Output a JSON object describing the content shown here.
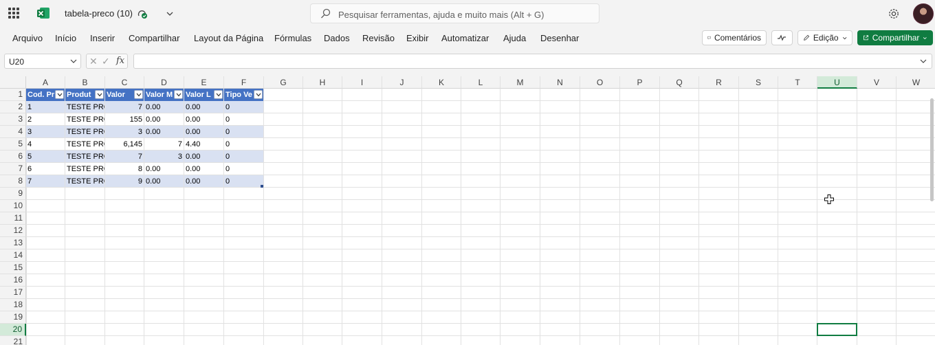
{
  "app": {
    "doc_title": "tabela-preco (10)",
    "search_placeholder": "Pesquisar ferramentas, ajuda e muito mais (Alt + G)"
  },
  "menu": [
    "Arquivo",
    "Início",
    "Inserir",
    "Compartilhar",
    "Layout da Página",
    "Fórmulas",
    "Dados",
    "Revisão",
    "Exibir",
    "Automatizar",
    "Ajuda",
    "Desenhar"
  ],
  "ribbon_buttons": {
    "comments": "Comentários",
    "editing": "Edição",
    "share": "Compartilhar"
  },
  "formula_bar": {
    "name_box": "U20",
    "formula": ""
  },
  "columns": [
    "A",
    "B",
    "C",
    "D",
    "E",
    "F",
    "G",
    "H",
    "I",
    "J",
    "K",
    "L",
    "M",
    "N",
    "O",
    "P",
    "Q",
    "R",
    "S",
    "T",
    "U",
    "V",
    "W"
  ],
  "rows": [
    "1",
    "2",
    "3",
    "4",
    "5",
    "6",
    "7",
    "8",
    "9",
    "10",
    "11",
    "12",
    "13",
    "14",
    "15",
    "16",
    "17",
    "18",
    "19",
    "20",
    "21"
  ],
  "selected": {
    "column": "U",
    "row": "20"
  },
  "table": {
    "headers": [
      "Cod. Pr",
      "Produt",
      "Valor",
      "Valor M",
      "Valor L",
      "Tipo Ve"
    ],
    "rows": [
      [
        "1",
        "TESTE PRC",
        "7",
        "0.00",
        "0.00",
        "0"
      ],
      [
        "2",
        "TESTE PRC",
        "155",
        "0.00",
        "0.00",
        "0"
      ],
      [
        "3",
        "TESTE PRC",
        "3",
        "0.00",
        "0.00",
        "0"
      ],
      [
        "4",
        "TESTE PRC",
        "6,145",
        "7",
        "4.40",
        "0"
      ],
      [
        "5",
        "TESTE PRC",
        "7",
        "3",
        "0.00",
        "0"
      ],
      [
        "6",
        "TESTE PRC",
        "8",
        "0.00",
        "0.00",
        "0"
      ],
      [
        "7",
        "TESTE PRC",
        "9",
        "0.00",
        "0.00",
        "0"
      ]
    ]
  },
  "colors": {
    "accent": "#107c41",
    "table_header": "#4472c4",
    "table_band": "#d9e1f2"
  }
}
